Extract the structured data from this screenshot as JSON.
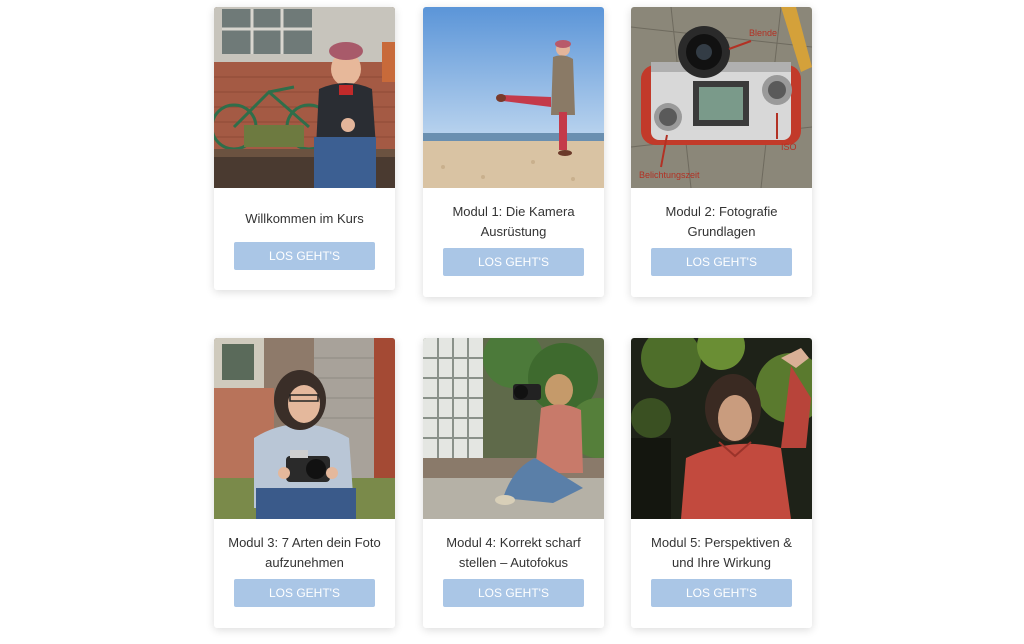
{
  "cards": [
    {
      "title": "Willkommen im Kurs",
      "button_label": "LOS GEHT'S"
    },
    {
      "title": "Modul 1: Die Kamera Ausrüstung",
      "button_label": "LOS GEHT'S"
    },
    {
      "title": "Modul 2: Fotografie Grundlagen",
      "button_label": "LOS GEHT'S"
    },
    {
      "title": "Modul 3: 7 Arten dein Foto aufzunehmen",
      "button_label": "LOS GEHT'S"
    },
    {
      "title": "Modul 4: Korrekt scharf stellen – Autofokus",
      "button_label": "LOS GEHT'S"
    },
    {
      "title": "Modul 5: Perspektiven & und Ihre Wirkung",
      "button_label": "LOS GEHT'S"
    }
  ],
  "camera_labels": {
    "aperture": "Blende",
    "iso": "ISO",
    "shutter": "Belichtungszeit"
  },
  "colors": {
    "button": "#aac6e6",
    "button_text": "#ffffff",
    "title_text": "#333333",
    "label_red": "#b23124"
  }
}
